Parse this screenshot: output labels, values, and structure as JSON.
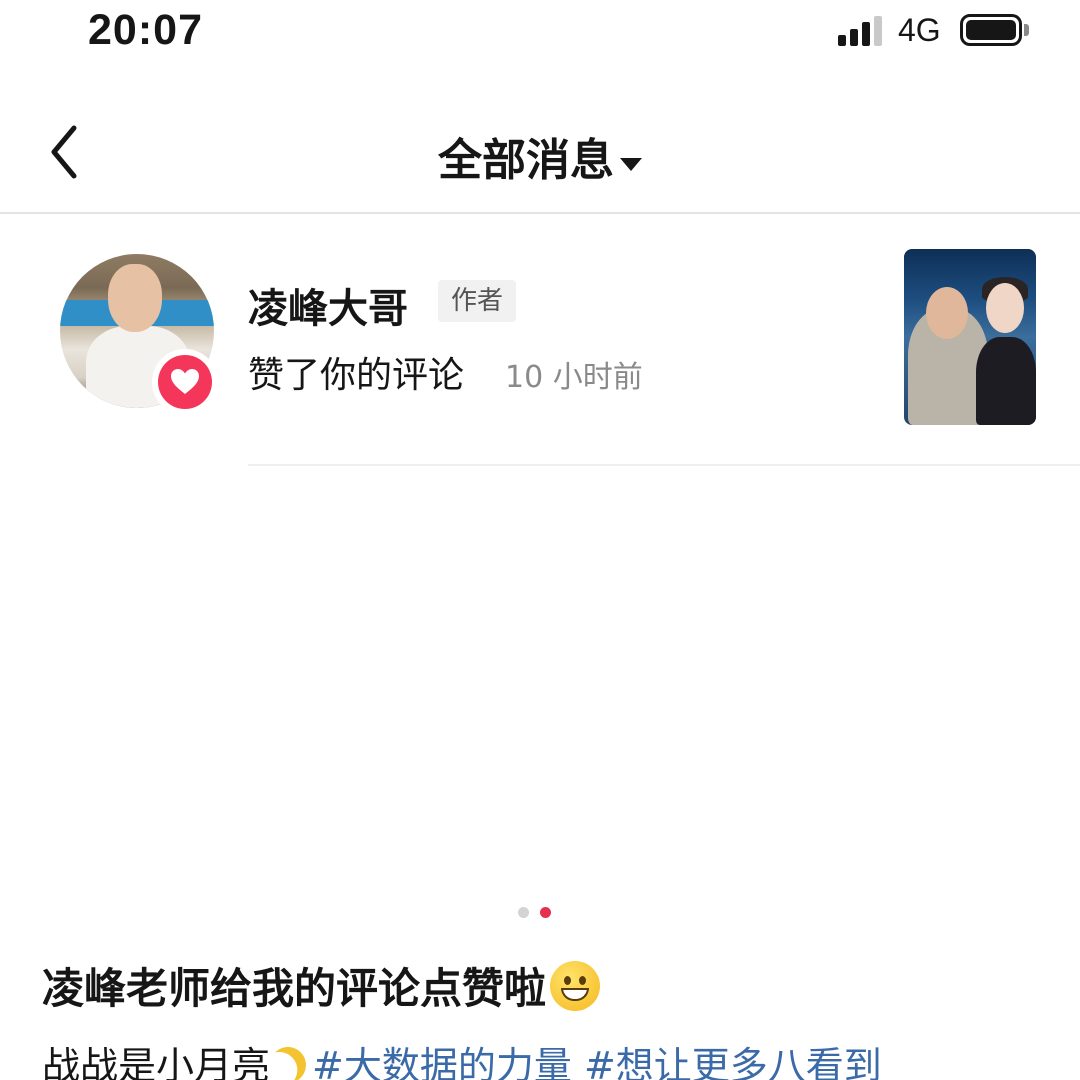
{
  "status_bar": {
    "time": "20:07",
    "network": "4G"
  },
  "header": {
    "title": "全部消息"
  },
  "message": {
    "username": "凌峰大哥",
    "author_tag": "作者",
    "action": "赞了你的评论",
    "time": "10 小时前"
  },
  "carousel": {
    "total": 2,
    "active_index": 1
  },
  "post": {
    "title": "凌峰老师给我的评论点赞啦",
    "author": "战战是小月亮",
    "hashtag_1": "#大数据的力量",
    "hashtag_2": "#想让更多八看到"
  },
  "colors": {
    "like_red": "#f3365a",
    "dot_active": "#e5304f",
    "hashtag_blue": "#3b6aa8"
  }
}
